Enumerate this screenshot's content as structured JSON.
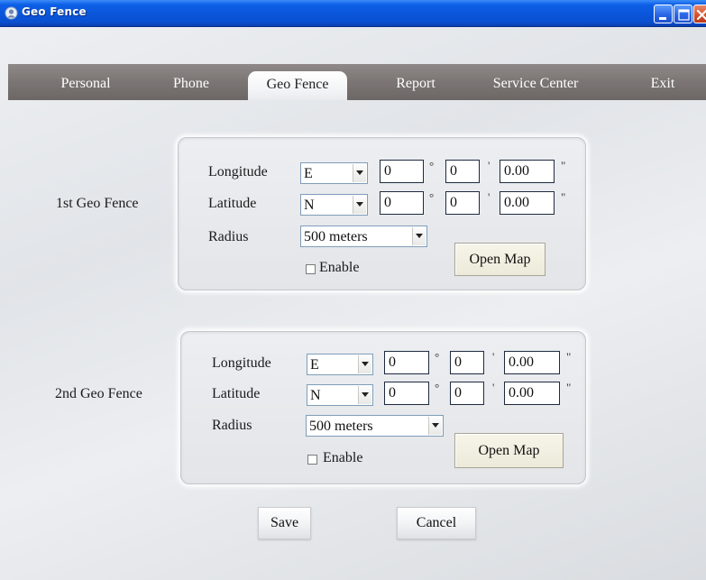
{
  "window": {
    "title": "Geo Fence",
    "colors": {
      "titlebar": "#0a54d8",
      "tabbar": "#7b7574",
      "close_button": "#d4532f"
    }
  },
  "tabs": [
    {
      "label": "Personal",
      "active": false
    },
    {
      "label": "Phone",
      "active": false
    },
    {
      "label": "Geo Fence",
      "active": true
    },
    {
      "label": "Report",
      "active": false
    },
    {
      "label": "Service Center",
      "active": false
    },
    {
      "label": "Exit",
      "active": false
    }
  ],
  "fences": [
    {
      "title": "1st Geo Fence",
      "longitude": {
        "label": "Longitude",
        "hemisphere": "E",
        "degrees": "0",
        "minutes": "0",
        "seconds": "0.00"
      },
      "latitude": {
        "label": "Latitude",
        "hemisphere": "N",
        "degrees": "0",
        "minutes": "0",
        "seconds": "0.00"
      },
      "radius": {
        "label": "Radius",
        "value": "500 meters"
      },
      "enable": {
        "label": "Enable",
        "checked": false
      },
      "open_map_label": "Open Map"
    },
    {
      "title": "2nd Geo Fence",
      "longitude": {
        "label": "Longitude",
        "hemisphere": "E",
        "degrees": "0",
        "minutes": "0",
        "seconds": "0.00"
      },
      "latitude": {
        "label": "Latitude",
        "hemisphere": "N",
        "degrees": "0",
        "minutes": "0",
        "seconds": "0.00"
      },
      "radius": {
        "label": "Radius",
        "value": "500 meters"
      },
      "enable": {
        "label": "Enable",
        "checked": false
      },
      "open_map_label": "Open Map"
    }
  ],
  "units": {
    "degree": "°",
    "minute": "'",
    "second": "\""
  },
  "actions": {
    "save_label": "Save",
    "cancel_label": "Cancel"
  }
}
